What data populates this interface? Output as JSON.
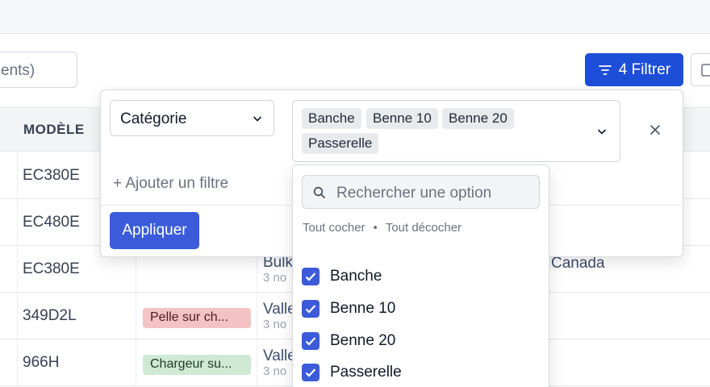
{
  "toolbar": {
    "search_value": "ents)",
    "filter_button_label": "4 Filtrer"
  },
  "table": {
    "header_model": "MODÈLE",
    "rows": [
      {
        "model": "EC380E",
        "tag": "",
        "location": "",
        "sub": ""
      },
      {
        "model": "EC480E",
        "tag": "",
        "location": "",
        "sub": ""
      },
      {
        "model": "EC380E",
        "tag": "",
        "location": "Bulk",
        "sub": "3 no",
        "country": "Canada"
      },
      {
        "model": "349D2L",
        "tag": "Pelle sur ch...",
        "location": "Valle",
        "sub": "3 no"
      },
      {
        "model": "966H",
        "tag": "Chargeur su...",
        "location": "Valle",
        "sub": "3 no"
      }
    ]
  },
  "filter_panel": {
    "field_value": "Catégorie",
    "selected_chips": [
      "Banche",
      "Benne 10",
      "Benne 20",
      "Passerelle"
    ],
    "add_filter_label": "+ Ajouter un filtre",
    "apply_label": "Appliquer"
  },
  "options_dropdown": {
    "search_placeholder": "Rechercher une option",
    "select_all": "Tout cocher",
    "separator": "•",
    "deselect_all": "Tout décocher",
    "options": [
      {
        "label": "Banche",
        "checked": true
      },
      {
        "label": "Benne 10",
        "checked": true
      },
      {
        "label": "Benne 20",
        "checked": true
      },
      {
        "label": "Passerelle",
        "checked": true
      }
    ]
  },
  "colors": {
    "primary": "#1d4ed8",
    "apply": "#3b5bdb",
    "tag_red": "#f3c2c2",
    "tag_green": "#cfe9d5"
  },
  "icons": [
    "filter-icon",
    "chevron-down-icon",
    "close-icon",
    "search-icon",
    "checkmark-icon"
  ]
}
